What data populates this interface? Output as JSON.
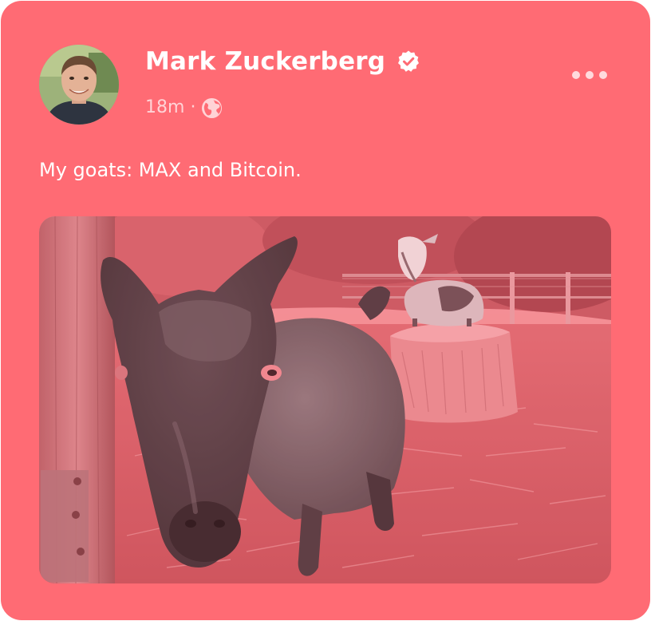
{
  "post": {
    "author": {
      "name": "Mark Zuckerberg",
      "verified": true,
      "avatar_icon": "profile-photo"
    },
    "timestamp": "18m",
    "separator": "·",
    "audience_icon": "globe-icon",
    "text": "My goats: MAX and Bitcoin.",
    "photo": {
      "alt": "goat-photo"
    },
    "menu_icon": "more-options-icon"
  },
  "colors": {
    "card_background": "#ff6b74",
    "text_primary": "#ffffff",
    "text_secondary": "#ffd3d6",
    "verified_badge": "#ffffff"
  }
}
